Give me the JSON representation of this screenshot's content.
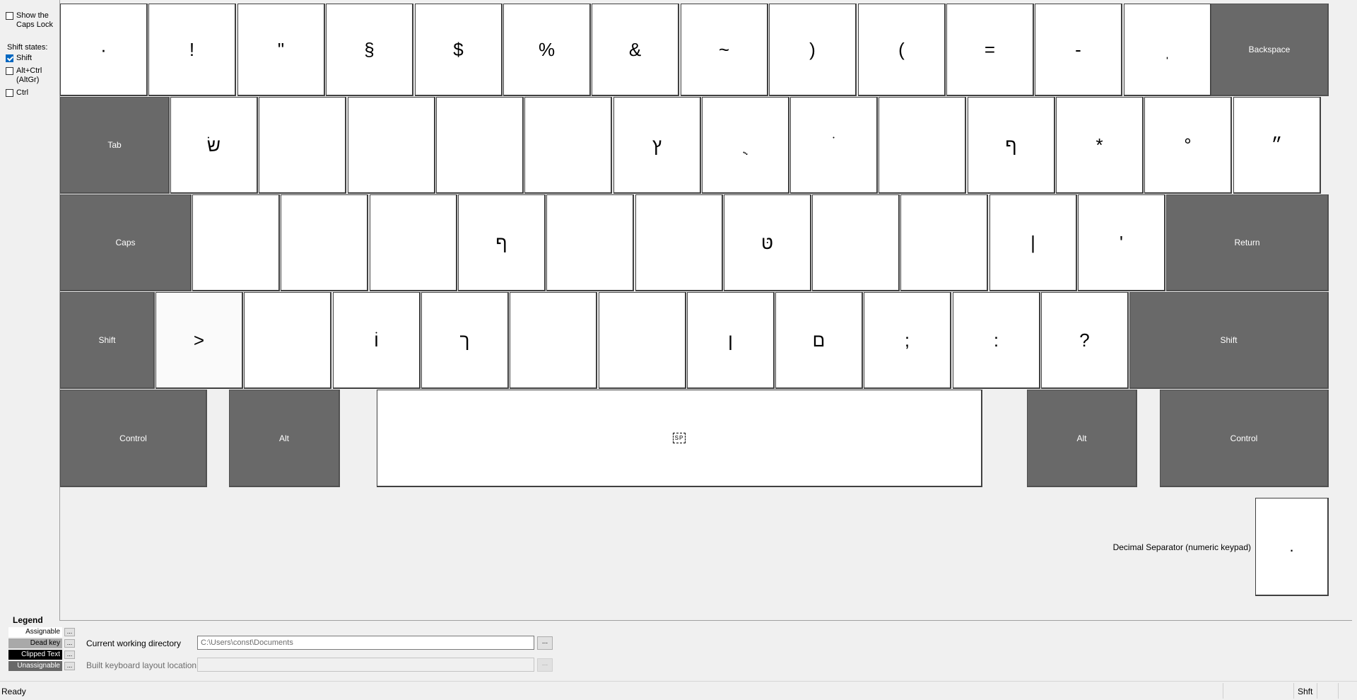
{
  "sidebar": {
    "caps_lock_label": "Show the Caps Lock",
    "shift_states_title": "Shift states:",
    "states": [
      {
        "label": "Shift",
        "checked": true
      },
      {
        "label": "Alt+Ctrl (AltGr)",
        "checked": false
      },
      {
        "label": "Ctrl",
        "checked": false
      }
    ]
  },
  "keyboard": {
    "row1": [
      "·",
      "!",
      "\"",
      "§",
      "$",
      "%",
      "&",
      "~",
      ")",
      "(",
      "=",
      "-",
      "ֽ"
    ],
    "row2": [
      "שׂ",
      "",
      "",
      "",
      "",
      "ץ",
      "ֻ",
      "ֹ",
      "",
      "ף",
      "*",
      "°",
      "״"
    ],
    "row3": [
      "",
      "",
      "",
      "ף",
      "",
      "",
      "טּ",
      "",
      "",
      "|",
      "'"
    ],
    "row4": [
      ">",
      "",
      "וֹ",
      "ך",
      "",
      "",
      "ן",
      "ם",
      ";",
      ":",
      "?"
    ],
    "space_label": "SP",
    "special": {
      "backspace": "Backspace",
      "tab": "Tab",
      "caps": "Caps",
      "return": "Return",
      "shift_left": "Shift",
      "shift_right": "Shift",
      "control_left": "Control",
      "alt_left": "Alt",
      "alt_right": "Alt",
      "control_right": "Control"
    },
    "decimal_label": "Decimal Separator (numeric keypad)",
    "decimal_value": "."
  },
  "legend": {
    "title": "Legend",
    "items": [
      {
        "label": "Assignable",
        "button": "..."
      },
      {
        "label": "Dead key",
        "button": "..."
      },
      {
        "label": "Clipped Text",
        "button": "..."
      },
      {
        "label": "Unassignable",
        "button": "..."
      }
    ]
  },
  "fields": {
    "cwd_label": "Current working directory",
    "cwd_value": "C:\\Users\\const\\Documents",
    "built_label": "Built keyboard layout location",
    "built_value": "",
    "browse": "..."
  },
  "status": {
    "text": "Ready",
    "shift": "Shft"
  }
}
